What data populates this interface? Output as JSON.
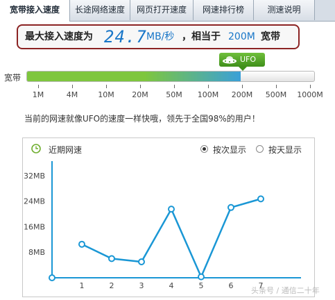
{
  "tabs": [
    {
      "label": "宽带接入速度",
      "active": true
    },
    {
      "label": "长途网络速度",
      "active": false
    },
    {
      "label": "网页打开速度",
      "active": false
    },
    {
      "label": "网速排行榜",
      "active": false
    },
    {
      "label": "测速说明",
      "active": false
    }
  ],
  "speed": {
    "prefix": "最大接入速度为",
    "value": "24.7",
    "unit": "MB/秒",
    "equiv_label": "，相当于",
    "equiv_value": "200M",
    "suffix": "宽带"
  },
  "bar": {
    "label": "宽带",
    "badge": "UFO",
    "fill_fraction": 0.745,
    "fill_color": "#7ec63e",
    "fill_color2": "#3aa0d8",
    "ticks": [
      "1M",
      "4M",
      "10M",
      "20M",
      "50M",
      "100M",
      "200M",
      "500M",
      "1000M"
    ]
  },
  "message": "当前的网速就像UFO的速度一样快哦，领先于全国98%的用户！",
  "chart_panel": {
    "title": "近期网速",
    "options": [
      {
        "label": "按次显示",
        "selected": true
      },
      {
        "label": "按天显示",
        "selected": false
      }
    ]
  },
  "chart_data": {
    "type": "line",
    "x": [
      1,
      2,
      3,
      4,
      5,
      6,
      7
    ],
    "xticks": [
      "1",
      "2",
      "3",
      "4",
      "5",
      "6",
      "7"
    ],
    "yticks": [
      "8MB",
      "16MB",
      "24MB",
      "32MB"
    ],
    "series": [
      {
        "values": [
          10.5,
          6,
          5,
          21.5,
          0.3,
          22,
          24.7
        ],
        "color": "#1a97d5"
      }
    ],
    "ylim": [
      0,
      40
    ],
    "xlim": [
      0,
      8
    ]
  },
  "watermark": "头条号 / 通信二十年"
}
